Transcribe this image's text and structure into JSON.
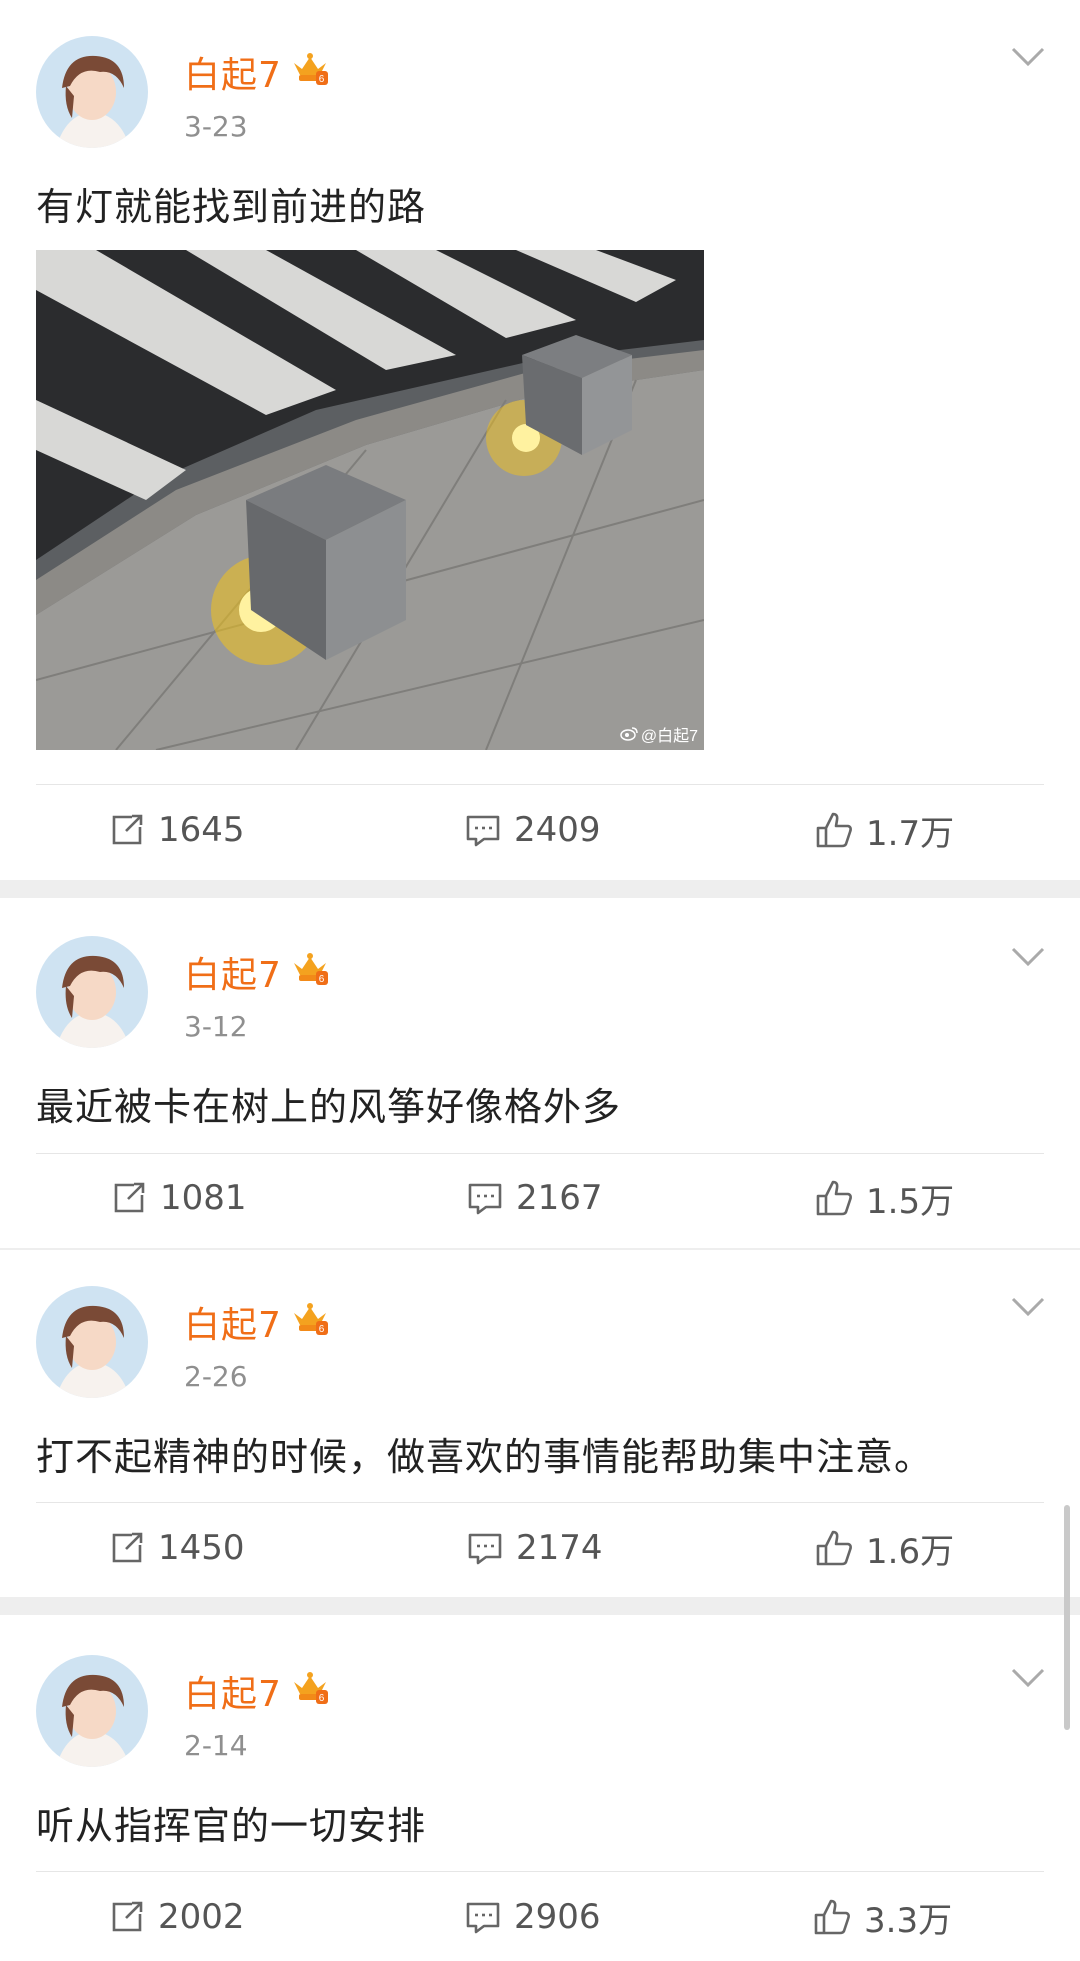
{
  "posts": [
    {
      "user": "白起7",
      "date": "3-23",
      "text": "有灯就能找到前进的路",
      "image_watermark": "@白起7",
      "reposts": "1645",
      "comments": "2409",
      "likes": "1.7万"
    },
    {
      "user": "白起7",
      "date": "3-12",
      "text": "最近被卡在树上的风筝好像格外多",
      "reposts": "1081",
      "comments": "2167",
      "likes": "1.5万"
    },
    {
      "user": "白起7",
      "date": "2-26",
      "text": "打不起精神的时候，做喜欢的事情能帮助集中注意。",
      "reposts": "1450",
      "comments": "2174",
      "likes": "1.6万"
    },
    {
      "user": "白起7",
      "date": "2-14",
      "text": "听从指挥官的一切安排",
      "reposts": "2002",
      "comments": "2906",
      "likes": "3.3万"
    }
  ],
  "icons": {
    "avatar": "avatar-icon",
    "badge": "crown-badge-icon",
    "menu": "chevron-down-icon",
    "repost": "repost-icon",
    "comment": "comment-icon",
    "like": "thumbs-up-icon"
  },
  "colors": {
    "username": "#f06e17",
    "date": "#8f8f8f",
    "separator": "#eeeeee"
  }
}
